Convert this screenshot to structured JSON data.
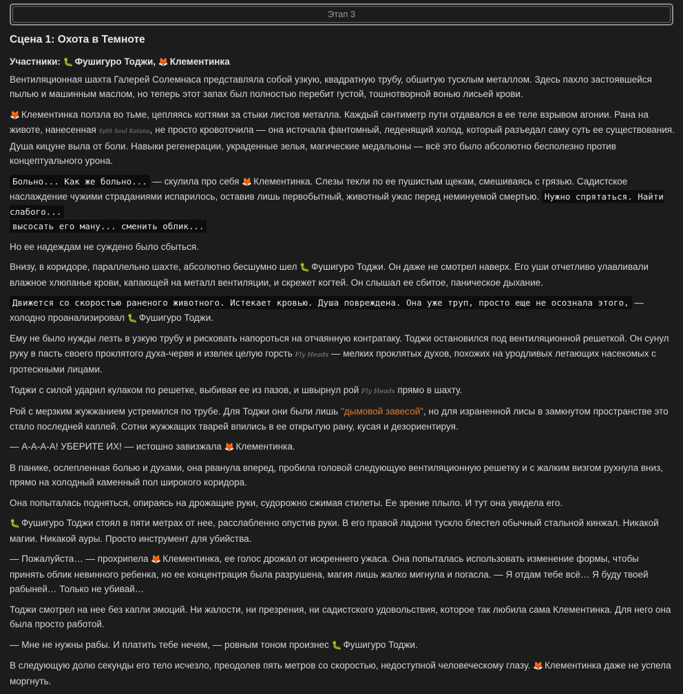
{
  "stage": {
    "label": "Этап 3"
  },
  "scene_title": "Сцена 1: Охота в Темноте",
  "participants": {
    "label": "Участники:",
    "toji": "Фушигуро Тоджи,",
    "clementine": "Клементинка"
  },
  "icons": {
    "fox": "🦊",
    "worm": "🐛"
  },
  "names": {
    "toji": "Фушигуро Тоджи",
    "clementine": "Клементинка"
  },
  "p1": "Вентиляционная шахта Галерей Солемнаса представляла собой узкую, квадратную трубу, обшитую тусклым металлом. Здесь пахло застоявшейся пылью и машинным маслом, но теперь этот запах был полностью перебит густой, тошнотворной вонью лисьей крови.",
  "p2": {
    "a": " ползла во тьме, цепляясь когтями за стыки листов металла. Каждый сантиметр пути отдавался в ее теле взрывом агонии. Рана на животе, нанесенная ",
    "weapon": "Split Soul Katana",
    "b": ", не просто кровоточила — она источала фантомный, леденящий холод, который разъедал саму суть ее существования. Душа кицуне выла от боли. Навыки регенерации, украденные зелья, магические медальоны — всё это было абсолютно бесполезно против концептуального урона."
  },
  "p3": {
    "code1": "Больно... Как же больно...",
    "a": " — скулила про себя ",
    "b": ". Слезы текли по ее пушистым щекам, смешиваясь с грязью. Садистское наслаждение чужими страданиями испарилось, оставив лишь первобытный, животный ужас перед неминуемой смертью. ",
    "code2": "Нужно спрятаться. Найти слабого...",
    "code3": "высосать его ману... сменить облик..."
  },
  "p4": "Но ее надеждам не суждено было сбыться.",
  "p5": {
    "a": "Внизу, в коридоре, параллельно шахте, абсолютно бесшумно шел ",
    "b": ". Он даже не смотрел наверх. Его уши отчетливо улавливали влажное хлюпанье крови, капающей на металл вентиляции, и скрежет когтей. Он слышал ее сбитое, паническое дыхание."
  },
  "p6": {
    "code": "Движется со скоростью раненого животного. Истекает кровью. Душа повреждена. Она уже труп, просто еще не осознала этого,",
    "a": " — холодно проанализировал ",
    "b": "."
  },
  "p7": {
    "a": "Ему не было нужды лезть в узкую трубу и рисковать напороться на отчаянную контратаку. Тоджи остановился под вентиляционной решеткой. Он сунул руку в пасть своего проклятого духа-червя и извлек целую горсть ",
    "fly": "Fly Heads",
    "b": " — мелких проклятых духов, похожих на уродливых летающих насекомых с гротескными лицами."
  },
  "p8": {
    "a": "Тоджи с силой ударил кулаком по решетке, выбивая ее из пазов, и швырнул рой ",
    "fly": "Fly Heads",
    "b": " прямо в шахту."
  },
  "p9": {
    "a": "Рой с мерзким жужжанием устремился по трубе. Для Тоджи они были лишь ",
    "smoke": "\"дымовой завесой\"",
    "b": ", но для израненной лисы в замкнутом пространстве это стало последней каплей. Сотни жужжащих тварей впились в ее открытую рану, кусая и дезориентируя."
  },
  "p10": {
    "a": "— А-А-А-А! УБЕРИТЕ ИХ! — истошно завизжала ",
    "b": "."
  },
  "p11": "В панике, ослепленная болью и духами, она рванула вперед, пробила головой следующую вентиляционную решетку и с жалким визгом рухнула вниз, прямо на холодный каменный пол широкого коридора.",
  "p12": "Она попыталась подняться, опираясь на дрожащие руки, судорожно сжимая стилеты. Ее зрение плыло. И тут она увидела его.",
  "p13": " стоял в пяти метрах от нее, расслабленно опустив руки. В его правой ладони тускло блестел обычный стальной кинжал. Никакой магии. Никакой ауры. Просто инструмент для убийства.",
  "p14": {
    "a": "— Пожалуйста… — прохрипела ",
    "b": ", ее голос дрожал от искреннего ужаса. Она попыталась использовать изменение формы, чтобы принять облик невинного ребенка, но ее концентрация была разрушена, магия лишь жалко мигнула и погасла. — Я отдам тебе всё… Я буду твоей рабыней… Только не убивай…"
  },
  "p15": "Тоджи смотрел на нее без капли эмоций. Ни жалости, ни презрения, ни садистского удовольствия, которое так любила сама Клементинка. Для него она была просто работой.",
  "p16": {
    "a": "— Мне не нужны рабы. И платить тебе нечем, — ровным тоном произнес ",
    "b": "."
  },
  "p17": {
    "a": "В следующую долю секунды его тело исчезло, преодолев пять метров со скоростью, недоступной человеческому глазу. ",
    "b": " даже не успела моргнуть."
  }
}
